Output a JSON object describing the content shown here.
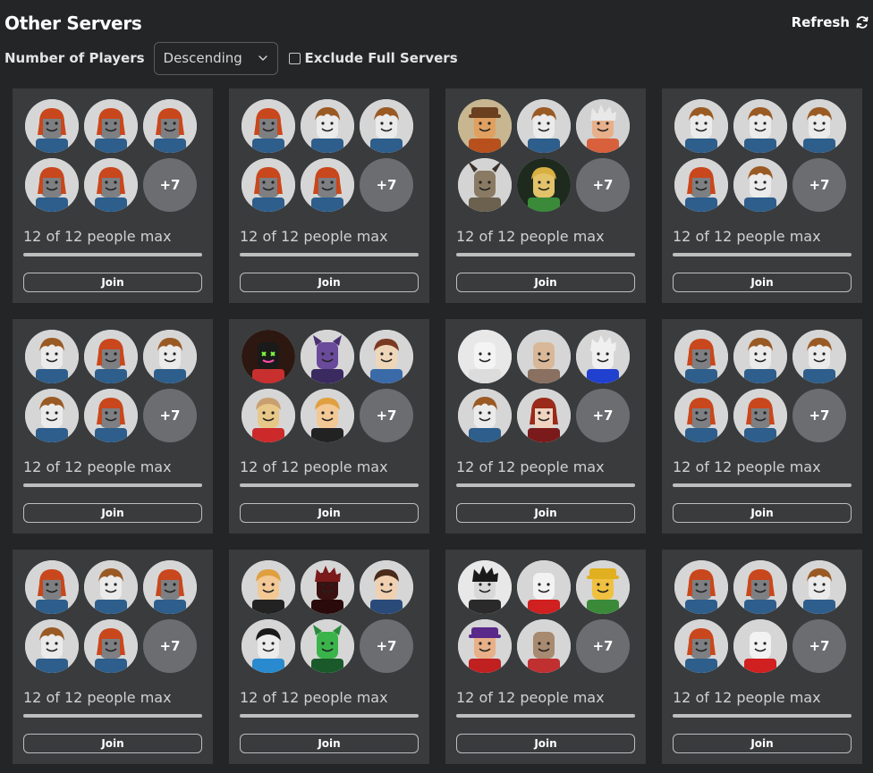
{
  "header": {
    "title": "Other Servers",
    "refresh_label": "Refresh"
  },
  "filters": {
    "sort_label": "Number of Players",
    "sort_value": "Descending",
    "exclude_label": "Exclude Full Servers",
    "exclude_checked": false
  },
  "colors": {
    "page_bg": "#232527",
    "card_bg": "#393b3d",
    "more_badge": "#6b6d70",
    "bar_fill": "#bdbebe"
  },
  "servers": [
    {
      "capacity_text": "12 of 12 people max",
      "fill_fraction": 1.0,
      "join_label": "Join",
      "more_label": "+7",
      "avatars": [
        "bacon-hair-female",
        "bacon-hair-female",
        "bacon-hair-female",
        "bacon-hair-female",
        "bacon-hair-female"
      ]
    },
    {
      "capacity_text": "12 of 12 people max",
      "fill_fraction": 1.0,
      "join_label": "Join",
      "more_label": "+7",
      "avatars": [
        "bacon-hair-female",
        "bacon-hair",
        "bacon-hair",
        "bacon-hair-female",
        "bacon-hair-female"
      ]
    },
    {
      "capacity_text": "12 of 12 people max",
      "fill_fraction": 1.0,
      "join_label": "Join",
      "more_label": "+7",
      "avatars": [
        "fancy-hat-avatar",
        "bacon-hair",
        "anime-white-hair",
        "goat-avatar",
        "green-aura-avatar"
      ]
    },
    {
      "capacity_text": "12 of 12 people max",
      "fill_fraction": 1.0,
      "join_label": "Join",
      "more_label": "+7",
      "avatars": [
        "bacon-hair",
        "bacon-hair",
        "bacon-hair",
        "bacon-hair-female",
        "bacon-hair"
      ]
    },
    {
      "capacity_text": "12 of 12 people max",
      "fill_fraction": 1.0,
      "join_label": "Join",
      "more_label": "+7",
      "avatars": [
        "bacon-hair",
        "bacon-hair-female",
        "bacon-hair",
        "bacon-hair",
        "bacon-hair-female"
      ]
    },
    {
      "capacity_text": "12 of 12 people max",
      "fill_fraction": 1.0,
      "join_label": "Join",
      "more_label": "+7",
      "avatars": [
        "neon-mask-avatar",
        "purple-cat-avatar",
        "brown-hair-avatar",
        "small-red-avatar",
        "blonde-boy-avatar"
      ]
    },
    {
      "capacity_text": "12 of 12 people max",
      "fill_fraction": 1.0,
      "join_label": "Join",
      "more_label": "+7",
      "avatars": [
        "white-smiley-avatar",
        "bald-bearded-avatar",
        "white-hair-glasses-avatar",
        "bacon-hair",
        "red-hair-avatar"
      ]
    },
    {
      "capacity_text": "12 of 12 people max",
      "fill_fraction": 1.0,
      "join_label": "Join",
      "more_label": "+7",
      "avatars": [
        "bacon-hair-female",
        "bacon-hair",
        "bacon-hair",
        "bacon-hair-female",
        "bacon-hair-female"
      ]
    },
    {
      "capacity_text": "12 of 12 people max",
      "fill_fraction": 1.0,
      "join_label": "Join",
      "more_label": "+7",
      "avatars": [
        "bacon-hair-female",
        "bacon-hair",
        "bacon-hair-female",
        "bacon-hair",
        "bacon-hair-female"
      ]
    },
    {
      "capacity_text": "12 of 12 people max",
      "fill_fraction": 1.0,
      "join_label": "Join",
      "more_label": "+7",
      "avatars": [
        "blonde-boy-avatar",
        "dark-red-avatar",
        "waving-avatar",
        "black-hair-avatar",
        "green-alien-avatar"
      ]
    },
    {
      "capacity_text": "12 of 12 people max",
      "fill_fraction": 1.0,
      "join_label": "Join",
      "more_label": "+7",
      "avatars": [
        "black-white-avatar",
        "classic-noob-face",
        "yellow-cap-glasses-avatar",
        "sunglasses-cap-avatar",
        "blocky-tan-avatar"
      ]
    },
    {
      "capacity_text": "12 of 12 people max",
      "fill_fraction": 1.0,
      "join_label": "Join",
      "more_label": "+7",
      "avatars": [
        "bacon-hair-female",
        "bacon-hair-female",
        "bacon-hair",
        "bacon-hair-female",
        "classic-noob-face"
      ]
    }
  ]
}
